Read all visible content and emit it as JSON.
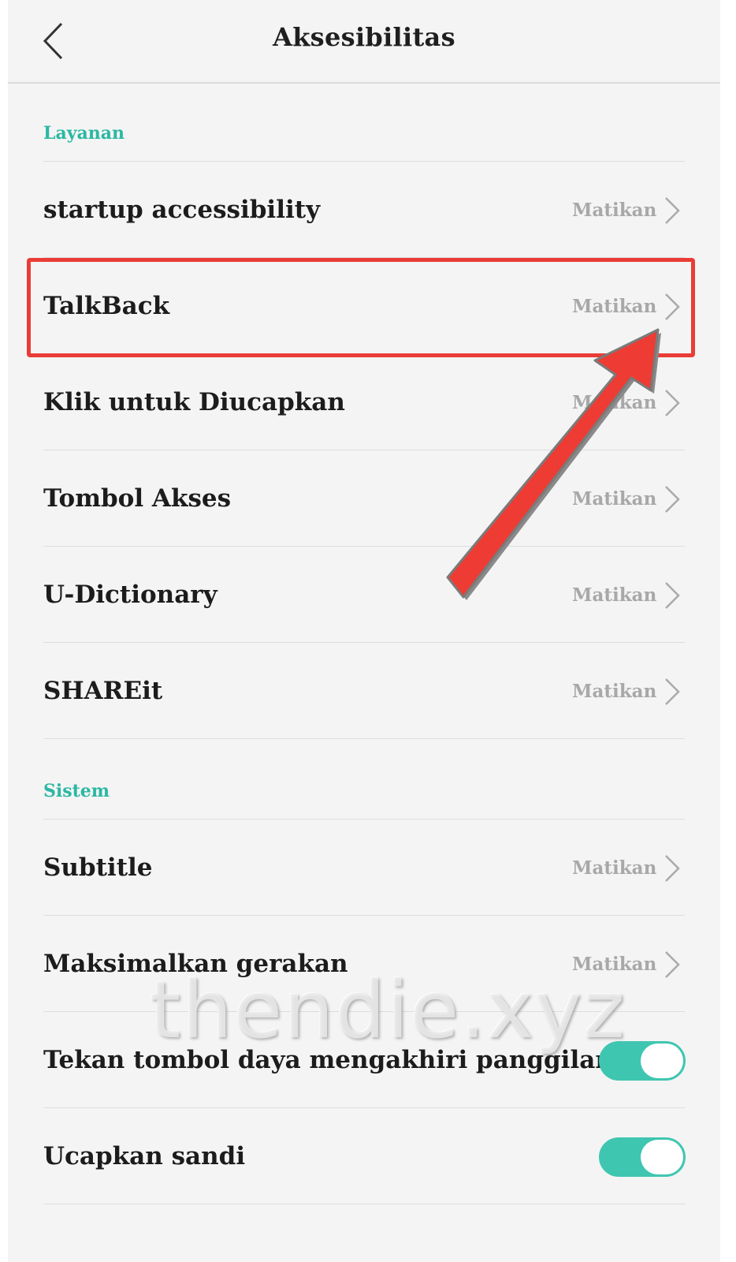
{
  "header": {
    "title": "Aksesibilitas"
  },
  "sections": {
    "layanan": "Layanan",
    "sistem": "Sistem"
  },
  "items": [
    {
      "label": "startup accessibility",
      "status": "Matikan"
    },
    {
      "label": "TalkBack",
      "status": "Matikan"
    },
    {
      "label": "Klik untuk Diucapkan",
      "status": "Matikan"
    },
    {
      "label": "Tombol Akses",
      "status": "Matikan"
    },
    {
      "label": "U-Dictionary",
      "status": "Matikan"
    },
    {
      "label": "SHAREit",
      "status": "Matikan"
    },
    {
      "label": "Subtitle",
      "status": "Matikan"
    },
    {
      "label": "Maksimalkan gerakan",
      "status": "Matikan"
    },
    {
      "label": "Tekan tombol daya mengakhiri panggilan",
      "toggle_on": true
    },
    {
      "label": "Ucapkan sandi",
      "toggle_on": true
    }
  ],
  "watermark": "thendie.xyz",
  "colors": {
    "accent": "#2bb8a3",
    "toggle": "#3fc6b0",
    "highlight": "#ea3c36"
  },
  "icons": {
    "back": "chevron-left-icon",
    "row": "chevron-right-icon"
  }
}
